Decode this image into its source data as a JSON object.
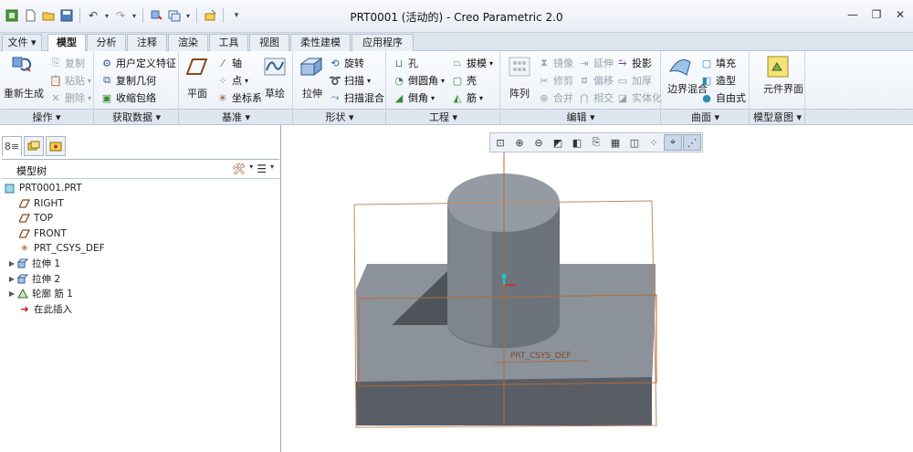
{
  "window": {
    "title": "PRT0001 (活动的) - Creo Parametric 2.0"
  },
  "quick_access": {
    "icons": [
      "app-icon",
      "new-icon",
      "open-icon",
      "save-icon",
      "undo-icon",
      "redo-icon",
      "regenerate-icon",
      "windows-icon",
      "close-window-icon",
      "customize-icon"
    ]
  },
  "tabs": [
    {
      "label": "文件 ▾"
    },
    {
      "label": "模型"
    },
    {
      "label": "分析"
    },
    {
      "label": "注释"
    },
    {
      "label": "渲染"
    },
    {
      "label": "工具"
    },
    {
      "label": "视图"
    },
    {
      "label": "柔性建模"
    },
    {
      "label": "应用程序"
    }
  ],
  "ribbon": {
    "operations": {
      "regenerate": "重新生成",
      "copy": "复制",
      "paste": "粘贴",
      "delete": "删除"
    },
    "get_data": {
      "udf": "用户定义特征",
      "copy_geom": "复制几何",
      "shrinkwrap": "收缩包络"
    },
    "datum": {
      "plane": "平面",
      "axis": "轴",
      "point": "点",
      "csys": "坐标系",
      "sketch": "草绘"
    },
    "shapes": {
      "extrude": "拉伸",
      "revolve": "旋转",
      "sweep": "扫描",
      "swept_blend": "扫描混合"
    },
    "engineering": {
      "hole": "孔",
      "round": "倒圆角",
      "chamfer": "倒角",
      "draft": "拔模",
      "shell": "壳",
      "rib": "筋"
    },
    "editing": {
      "pattern": "阵列",
      "mirror": "镜像",
      "trim": "修剪",
      "merge": "合并",
      "extend": "延伸",
      "offset": "偏移",
      "intersect": "相交",
      "project": "投影",
      "thicken": "加厚",
      "solidify": "实体化"
    },
    "surfaces": {
      "boundary_blend": "边界混合",
      "fill": "填充",
      "style": "造型",
      "freestyle": "自由式"
    },
    "intent": {
      "component_interface": "元件界面"
    }
  },
  "group_labels": [
    "操作 ▾",
    "获取数据 ▾",
    "基准 ▾",
    "形状 ▾",
    "工程 ▾",
    "编辑 ▾",
    "曲面 ▾",
    "模型意图 ▾"
  ],
  "model_tree": {
    "header": "模型树",
    "items": [
      {
        "label": "PRT0001.PRT",
        "icon": "part-icon",
        "expandable": false
      },
      {
        "label": "RIGHT",
        "icon": "datum-plane-icon",
        "expandable": false
      },
      {
        "label": "TOP",
        "icon": "datum-plane-icon",
        "expandable": false
      },
      {
        "label": "FRONT",
        "icon": "datum-plane-icon",
        "expandable": false
      },
      {
        "label": "PRT_CSYS_DEF",
        "icon": "csys-icon",
        "expandable": false
      },
      {
        "label": "拉伸 1",
        "icon": "extrude-icon",
        "expandable": true
      },
      {
        "label": "拉伸 2",
        "icon": "extrude-icon",
        "expandable": true
      },
      {
        "label": "轮廓 筋 1",
        "icon": "rib-icon",
        "expandable": true
      },
      {
        "label": "在此插入",
        "icon": "insert-here-icon",
        "expandable": false
      }
    ]
  },
  "viewport": {
    "csys_label": "PRT_CSYS_DEF",
    "toolbar_icons": [
      "refit-icon",
      "zoom-in-icon",
      "zoom-out-icon",
      "repaint-icon",
      "display-style-icon",
      "saved-views-icon",
      "view-manager-icon",
      "perspective-icon",
      "datum-display-icon",
      "spin-center-icon",
      "annotation-icon"
    ]
  }
}
